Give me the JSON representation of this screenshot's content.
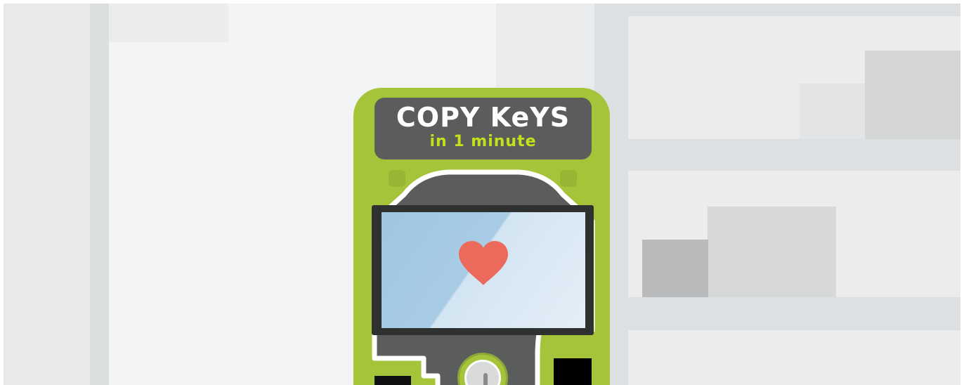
{
  "promo": {
    "title": "COPY KeYS",
    "subtitle": "in 1 minute"
  },
  "icons": {
    "screen_icon": "heart-icon",
    "key": "key-slot-icon"
  },
  "colors": {
    "machine_body": "#a5c43a",
    "logo_panel": "#5b5d5d",
    "subtitle_accent": "#c4e01a",
    "heart": "#ec6a5c",
    "screen": "#a9cce6",
    "background": "#f3f4f6"
  }
}
